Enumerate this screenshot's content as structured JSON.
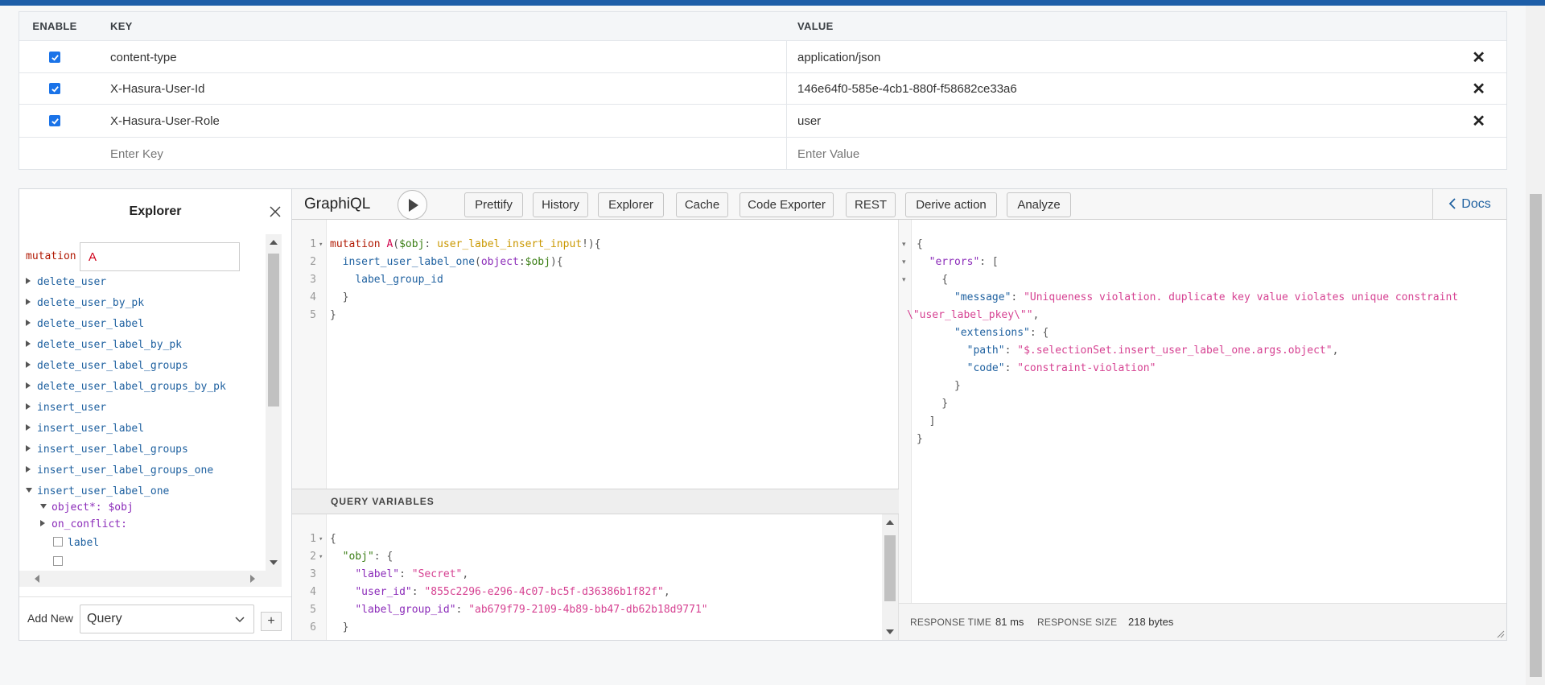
{
  "headers_table": {
    "columns": {
      "enable": "ENABLE",
      "key": "KEY",
      "value": "VALUE"
    },
    "rows": [
      {
        "enabled": true,
        "key": "content-type",
        "value": "application/json"
      },
      {
        "enabled": true,
        "key": "X-Hasura-User-Id",
        "value": "146e64f0-585e-4cb1-880f-f58682ce33a6"
      },
      {
        "enabled": true,
        "key": "X-Hasura-User-Role",
        "value": "user"
      }
    ],
    "new_row": {
      "key_placeholder": "Enter Key",
      "value_placeholder": "Enter Value"
    }
  },
  "explorer": {
    "title": "Explorer",
    "operation_keyword": "mutation",
    "operation_name": "A",
    "items": [
      "delete_user",
      "delete_user_by_pk",
      "delete_user_label",
      "delete_user_label_by_pk",
      "delete_user_label_groups",
      "delete_user_label_groups_by_pk",
      "insert_user",
      "insert_user_label",
      "insert_user_label_groups",
      "insert_user_label_groups_one",
      "insert_user_label_one"
    ],
    "sub_items": {
      "object": "object*: $obj",
      "on_conflict": "on_conflict:",
      "label": "label"
    },
    "footer": {
      "add_new": "Add New",
      "select_value": "Query",
      "plus": "+"
    }
  },
  "toolbar": {
    "title": "GraphiQL",
    "buttons": [
      "Prettify",
      "History",
      "Explorer",
      "Cache",
      "Code Exporter",
      "REST",
      "Derive action",
      "Analyze"
    ],
    "docs": "Docs"
  },
  "query_variables": {
    "title": "QUERY VARIABLES"
  },
  "response": {
    "time_label": "RESPONSE TIME",
    "time_value": "81 ms",
    "size_label": "RESPONSE SIZE",
    "size_value": "218 bytes"
  },
  "editor_text": {
    "q1_mutation": "mutation",
    "q1_name": "A",
    "q1_var": "$obj",
    "q1_type": "user_label_insert_input",
    "q2_field": "insert_user_label_one",
    "q2_arg": "object",
    "q2_var": "$obj",
    "q3_field": "label_group_id",
    "v_obj": "\"obj\"",
    "v_label_k": "\"label\"",
    "v_label_v": "\"Secret\"",
    "v_uid_k": "\"user_id\"",
    "v_uid_v": "\"855c2296-e296-4c07-bc5f-d36386b1f82f\"",
    "v_lgid_k": "\"label_group_id\"",
    "v_lgid_v": "\"ab679f79-2109-4b89-bb47-db62b18d9771\"",
    "r_errors": "\"errors\"",
    "r_message_k": "\"message\"",
    "r_message_v1": "\"Uniqueness violation. duplicate key value violates unique constraint",
    "r_message_v2": "\\\"user_label_pkey\\\"\"",
    "r_ext": "\"extensions\"",
    "r_path_k": "\"path\"",
    "r_path_v": "\"$.selectionSet.insert_user_label_one.args.object\"",
    "r_code_k": "\"code\"",
    "r_code_v": "\"constraint-violation\""
  },
  "colors": {
    "accent": "#1d5ea8",
    "checkbox": "#1a73e8",
    "link": "#1f61a0",
    "error_string": "#d64292"
  }
}
